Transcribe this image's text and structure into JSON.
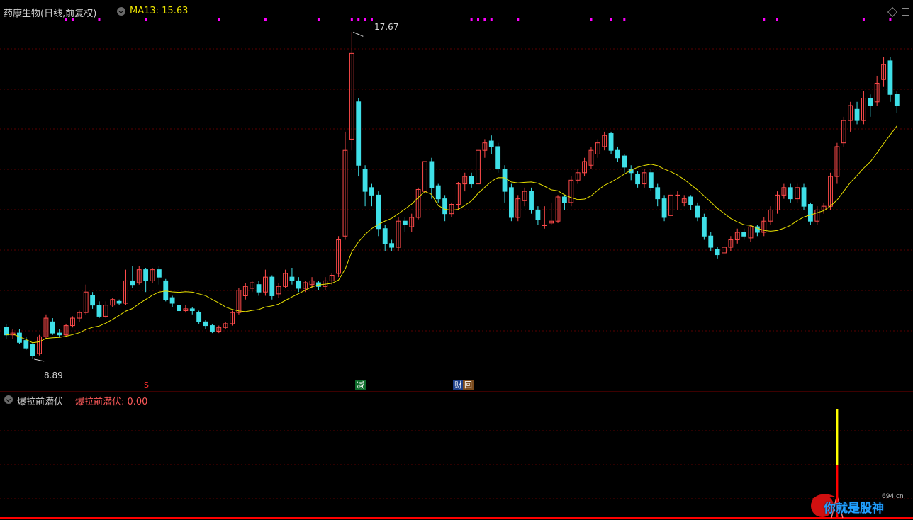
{
  "main_panel": {
    "title": "药康生物(日线,前复权)",
    "indicator_label": "MA13: 15.63",
    "high_label": "17.67",
    "low_label": "8.89"
  },
  "event_tags": {
    "s_mark": "S",
    "reduce": "减",
    "finance": "财",
    "buyback": "回"
  },
  "indicator_panel": {
    "title": "爆拉前潜伏",
    "value_label": "爆拉前潜伏: 0.00"
  },
  "watermark": {
    "site": "694.cn",
    "text": "你就是股神"
  },
  "colors": {
    "background": "#000000",
    "up": "#ff4a4a",
    "down": "#3fe0e8",
    "ma": "#e8e000",
    "grid": "#5a0000",
    "signal_top": "#ffff00",
    "signal_bottom": "#ff0000",
    "dots": "#ff00ff"
  },
  "chart_data": {
    "type": "candlestick",
    "title": "药康生物(日线,前复权)",
    "ylim": [
      8.5,
      18.0
    ],
    "highest": 17.67,
    "lowest": 8.89,
    "series": [
      {
        "name": "MA13",
        "last_value": 15.63
      }
    ],
    "candles": [
      [
        9.75,
        9.55,
        9.85,
        9.45
      ],
      [
        9.55,
        9.6,
        9.7,
        9.45
      ],
      [
        9.6,
        9.35,
        9.7,
        9.3
      ],
      [
        9.4,
        9.2,
        9.5,
        9.15
      ],
      [
        9.3,
        9.0,
        9.35,
        8.9
      ],
      [
        9.05,
        9.5,
        9.55,
        9.0
      ],
      [
        9.5,
        10.0,
        10.1,
        9.45
      ],
      [
        9.9,
        9.6,
        10.0,
        9.55
      ],
      [
        9.6,
        9.55,
        9.7,
        9.5
      ],
      [
        9.55,
        9.8,
        9.85,
        9.5
      ],
      [
        9.8,
        10.0,
        10.05,
        9.75
      ],
      [
        10.0,
        10.15,
        10.2,
        9.9
      ],
      [
        10.15,
        10.7,
        10.9,
        10.1
      ],
      [
        10.6,
        10.35,
        10.7,
        10.25
      ],
      [
        10.35,
        10.05,
        10.45,
        10.0
      ],
      [
        10.05,
        10.35,
        10.45,
        10.0
      ],
      [
        10.35,
        10.5,
        10.55,
        10.3
      ],
      [
        10.45,
        10.4,
        10.5,
        10.35
      ],
      [
        10.4,
        11.0,
        11.3,
        10.35
      ],
      [
        11.0,
        10.9,
        11.4,
        10.8
      ],
      [
        10.95,
        11.3,
        11.4,
        10.9
      ],
      [
        11.3,
        11.0,
        11.35,
        10.7
      ],
      [
        11.0,
        11.3,
        11.35,
        10.95
      ],
      [
        11.3,
        11.1,
        11.4,
        10.9
      ],
      [
        11.0,
        10.5,
        11.05,
        10.45
      ],
      [
        10.55,
        10.4,
        10.6,
        10.3
      ],
      [
        10.35,
        10.2,
        10.5,
        10.1
      ],
      [
        10.2,
        10.25,
        10.35,
        10.15
      ],
      [
        10.25,
        10.2,
        10.3,
        10.1
      ],
      [
        10.15,
        9.9,
        10.2,
        9.85
      ],
      [
        9.9,
        9.8,
        9.95,
        9.7
      ],
      [
        9.8,
        9.65,
        9.85,
        9.6
      ],
      [
        9.65,
        9.75,
        9.8,
        9.6
      ],
      [
        9.75,
        9.85,
        9.9,
        9.7
      ],
      [
        9.85,
        10.15,
        10.2,
        9.8
      ],
      [
        10.15,
        10.75,
        10.8,
        10.1
      ],
      [
        10.6,
        10.85,
        10.95,
        10.5
      ],
      [
        10.8,
        10.95,
        11.0,
        10.7
      ],
      [
        10.9,
        10.7,
        11.0,
        10.6
      ],
      [
        10.7,
        11.1,
        11.3,
        10.6
      ],
      [
        11.1,
        10.6,
        11.15,
        10.5
      ],
      [
        10.65,
        10.85,
        10.95,
        10.55
      ],
      [
        10.85,
        11.2,
        11.3,
        10.8
      ],
      [
        11.1,
        11.0,
        11.35,
        10.9
      ],
      [
        11.0,
        10.8,
        11.1,
        10.7
      ],
      [
        10.8,
        10.95,
        11.0,
        10.7
      ],
      [
        10.9,
        11.0,
        11.1,
        10.8
      ],
      [
        10.95,
        10.85,
        11.0,
        10.75
      ],
      [
        10.85,
        11.0,
        11.1,
        10.75
      ],
      [
        11.0,
        11.15,
        11.2,
        10.9
      ],
      [
        11.2,
        12.1,
        12.2,
        11.1
      ],
      [
        12.2,
        14.5,
        15.0,
        12.1
      ],
      [
        14.8,
        17.1,
        17.67,
        14.5
      ],
      [
        15.8,
        14.1,
        15.9,
        13.8
      ],
      [
        14.0,
        13.4,
        14.1,
        13.0
      ],
      [
        13.5,
        13.3,
        13.6,
        13.0
      ],
      [
        13.3,
        12.4,
        13.4,
        12.2
      ],
      [
        12.4,
        12.0,
        12.5,
        11.8
      ],
      [
        12.0,
        11.9,
        12.1,
        11.8
      ],
      [
        11.9,
        12.6,
        12.7,
        11.8
      ],
      [
        12.6,
        12.5,
        12.7,
        12.3
      ],
      [
        12.45,
        12.7,
        12.8,
        12.3
      ],
      [
        12.7,
        13.45,
        13.5,
        12.65
      ],
      [
        13.4,
        14.2,
        14.4,
        13.0
      ],
      [
        14.2,
        13.5,
        14.3,
        13.2
      ],
      [
        13.55,
        13.2,
        13.6,
        13.1
      ],
      [
        13.2,
        12.8,
        13.3,
        12.6
      ],
      [
        12.8,
        13.05,
        13.1,
        12.7
      ],
      [
        13.05,
        13.6,
        13.65,
        12.9
      ],
      [
        13.6,
        13.8,
        13.9,
        13.4
      ],
      [
        13.8,
        13.6,
        13.9,
        13.5
      ],
      [
        13.6,
        14.5,
        14.6,
        13.5
      ],
      [
        14.5,
        14.7,
        14.8,
        14.3
      ],
      [
        14.75,
        14.6,
        14.9,
        14.4
      ],
      [
        14.6,
        14.0,
        14.7,
        13.9
      ],
      [
        14.0,
        13.4,
        14.1,
        13.1
      ],
      [
        13.5,
        12.7,
        13.6,
        12.6
      ],
      [
        12.7,
        13.2,
        13.3,
        12.6
      ],
      [
        13.15,
        13.4,
        13.5,
        13.0
      ],
      [
        13.4,
        12.9,
        13.5,
        12.8
      ],
      [
        12.9,
        12.65,
        13.0,
        12.5
      ],
      [
        12.5,
        12.5,
        13.0,
        12.4
      ],
      [
        12.55,
        12.6,
        13.1,
        12.5
      ],
      [
        12.6,
        13.25,
        13.3,
        12.55
      ],
      [
        13.25,
        13.1,
        13.3,
        12.9
      ],
      [
        13.1,
        13.7,
        13.8,
        13.0
      ],
      [
        13.7,
        13.9,
        14.0,
        13.6
      ],
      [
        13.9,
        14.2,
        14.3,
        13.8
      ],
      [
        14.1,
        14.5,
        14.6,
        14.0
      ],
      [
        14.4,
        14.7,
        14.8,
        14.3
      ],
      [
        14.6,
        14.9,
        15.0,
        14.5
      ],
      [
        14.95,
        14.5,
        15.0,
        14.4
      ],
      [
        14.5,
        14.3,
        14.6,
        14.2
      ],
      [
        14.35,
        14.05,
        14.4,
        13.9
      ],
      [
        14.0,
        13.9,
        14.1,
        13.7
      ],
      [
        13.85,
        13.6,
        13.95,
        13.5
      ],
      [
        13.6,
        13.9,
        14.0,
        13.5
      ],
      [
        13.9,
        13.5,
        14.0,
        13.4
      ],
      [
        13.5,
        13.2,
        13.6,
        13.0
      ],
      [
        13.2,
        12.7,
        13.3,
        12.6
      ],
      [
        12.75,
        13.3,
        13.4,
        12.65
      ],
      [
        13.3,
        13.3,
        13.4,
        12.9
      ],
      [
        13.1,
        13.2,
        13.3,
        13.0
      ],
      [
        13.25,
        13.05,
        13.3,
        12.9
      ],
      [
        13.0,
        12.7,
        13.1,
        12.6
      ],
      [
        12.7,
        12.2,
        12.8,
        12.1
      ],
      [
        12.2,
        11.9,
        12.3,
        11.8
      ],
      [
        11.85,
        11.7,
        11.9,
        11.6
      ],
      [
        11.75,
        11.9,
        12.0,
        11.7
      ],
      [
        11.9,
        12.1,
        12.2,
        11.8
      ],
      [
        12.1,
        12.3,
        12.4,
        12.0
      ],
      [
        12.3,
        12.2,
        12.4,
        12.1
      ],
      [
        12.15,
        12.45,
        12.5,
        12.05
      ],
      [
        12.45,
        12.3,
        12.5,
        12.2
      ],
      [
        12.3,
        12.6,
        12.7,
        12.2
      ],
      [
        12.6,
        12.9,
        13.0,
        12.5
      ],
      [
        12.9,
        13.3,
        13.4,
        12.8
      ],
      [
        13.3,
        13.5,
        13.6,
        13.2
      ],
      [
        13.5,
        13.2,
        13.6,
        13.1
      ],
      [
        13.2,
        13.5,
        13.6,
        13.1
      ],
      [
        13.5,
        13.0,
        13.6,
        12.9
      ],
      [
        13.05,
        12.6,
        13.1,
        12.5
      ],
      [
        12.6,
        12.9,
        13.0,
        12.5
      ],
      [
        12.9,
        13.0,
        13.1,
        12.8
      ],
      [
        13.0,
        13.8,
        13.9,
        12.9
      ],
      [
        13.8,
        14.6,
        14.7,
        13.6
      ],
      [
        14.7,
        15.3,
        15.4,
        14.6
      ],
      [
        15.3,
        15.7,
        15.8,
        15.0
      ],
      [
        15.6,
        15.3,
        15.8,
        15.2
      ],
      [
        15.3,
        15.9,
        16.1,
        15.2
      ],
      [
        15.9,
        15.7,
        16.0,
        15.4
      ],
      [
        15.8,
        16.3,
        16.5,
        15.7
      ],
      [
        16.4,
        16.8,
        17.0,
        16.2
      ],
      [
        16.9,
        16.0,
        17.0,
        15.8
      ],
      [
        16.0,
        15.7,
        16.1,
        15.5
      ]
    ],
    "indicator": {
      "name": "爆拉前潜伏",
      "value": 0.0,
      "spike_index": 125
    }
  }
}
